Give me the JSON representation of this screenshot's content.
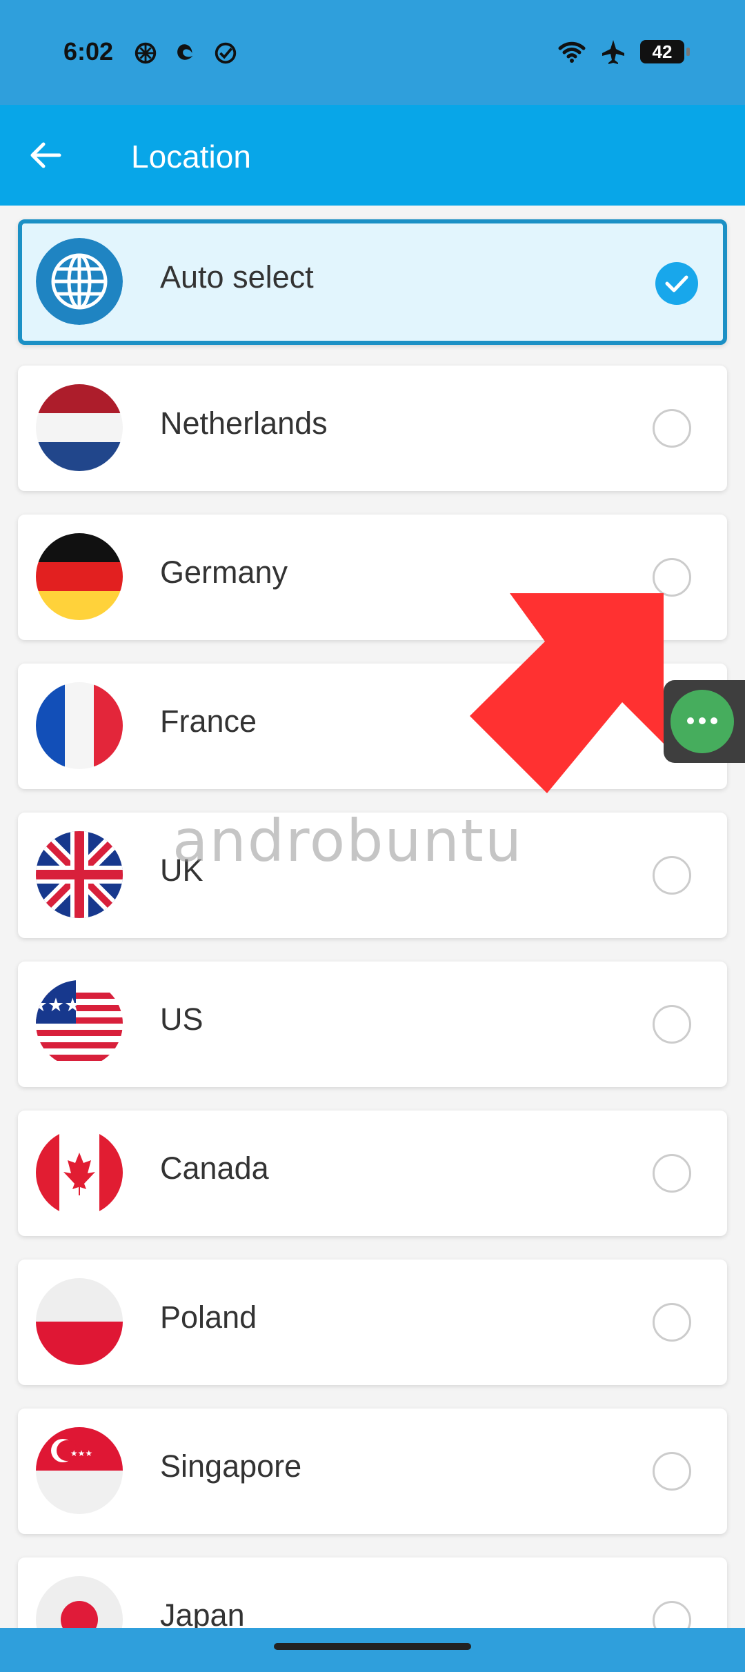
{
  "status_bar": {
    "time": "6:02",
    "battery": "42",
    "left_icons": [
      "chatgpt-icon",
      "edge-icon",
      "check-circle-icon"
    ],
    "right_icons": [
      "wifi-icon",
      "airplane-mode-icon",
      "battery-icon"
    ]
  },
  "app_bar": {
    "title": "Location",
    "back_icon": "arrow-left-icon"
  },
  "locations": [
    {
      "label": "Auto select",
      "selected": true,
      "icon": "globe-icon"
    },
    {
      "label": "Netherlands",
      "selected": false,
      "icon": "netherlands-flag-icon"
    },
    {
      "label": "Germany",
      "selected": false,
      "icon": "germany-flag-icon"
    },
    {
      "label": "France",
      "selected": false,
      "icon": "france-flag-icon"
    },
    {
      "label": "UK",
      "selected": false,
      "icon": "uk-flag-icon"
    },
    {
      "label": "US",
      "selected": false,
      "icon": "us-flag-icon"
    },
    {
      "label": "Canada",
      "selected": false,
      "icon": "canada-flag-icon"
    },
    {
      "label": "Poland",
      "selected": false,
      "icon": "poland-flag-icon"
    },
    {
      "label": "Singapore",
      "selected": false,
      "icon": "singapore-flag-icon"
    },
    {
      "label": "Japan",
      "selected": false,
      "icon": "japan-flag-icon"
    }
  ],
  "overlay": {
    "watermark": "androbuntu",
    "arrow": "red-arrow-icon",
    "floating_button": "more-horizontal-icon"
  },
  "colors": {
    "status_bar": "#2f9fdc",
    "app_bar": "#08a6e8",
    "selected_border": "#1b90c5",
    "selected_background": "#e2f5fd",
    "check": "#18a7eb",
    "arrow": "#ff3131",
    "floating_button": "#46ad5d"
  }
}
